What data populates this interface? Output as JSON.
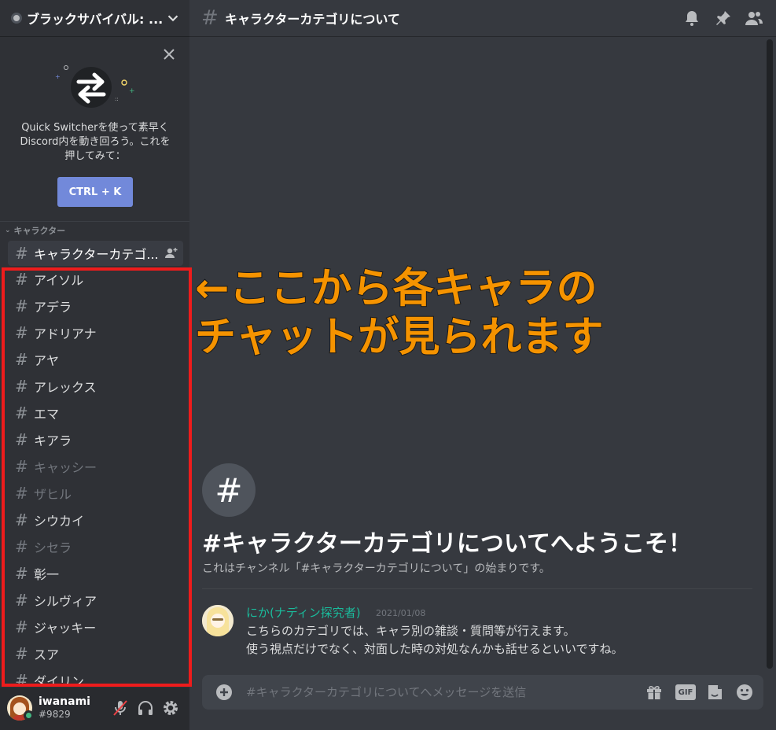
{
  "server": {
    "name": "ブラックサバイバル: ..."
  },
  "quick_switcher": {
    "text_lines": [
      "Quick Switcherを使って素早く",
      "Discord内を動き回ろう。これを",
      "押してみて："
    ],
    "button_label": "CTRL + K"
  },
  "category": {
    "label": "キャラクター"
  },
  "active_channel": {
    "name": "キャラクターカテゴ..."
  },
  "channels": [
    {
      "name": "アイソル",
      "muted": false
    },
    {
      "name": "アデラ",
      "muted": false
    },
    {
      "name": "アドリアナ",
      "muted": false
    },
    {
      "name": "アヤ",
      "muted": false
    },
    {
      "name": "アレックス",
      "muted": false
    },
    {
      "name": "エマ",
      "muted": false
    },
    {
      "name": "キアラ",
      "muted": false
    },
    {
      "name": "キャッシー",
      "muted": true
    },
    {
      "name": "ザヒル",
      "muted": true
    },
    {
      "name": "シウカイ",
      "muted": false
    },
    {
      "name": "シセラ",
      "muted": true
    },
    {
      "name": "彰一",
      "muted": false
    },
    {
      "name": "シルヴィア",
      "muted": false
    },
    {
      "name": "ジャッキー",
      "muted": false
    },
    {
      "name": "スア",
      "muted": false
    },
    {
      "name": "ダイリン",
      "muted": false
    }
  ],
  "user": {
    "name": "iwanami",
    "discriminator": "#9829",
    "status_color": "#43b581"
  },
  "topbar": {
    "channel_title": "キャラクターカテゴリについて"
  },
  "welcome": {
    "title": "#キャラクターカテゴリについてへようこそ！",
    "subtitle": "これはチャンネル「#キャラクターカテゴリについて」の始まりです。"
  },
  "message": {
    "author": "にか(ナディン探究者)",
    "timestamp": "2021/01/08",
    "lines": [
      "こちらのカテゴリでは、キャラ別の雑談・質問等が行えます。",
      "使う視点だけでなく、対面した時の対処なんかも話せるといいですね。"
    ]
  },
  "composer": {
    "placeholder": "#キャラクターカテゴリについてへメッセージを送信",
    "gif_label": "GIF"
  },
  "annotation": {
    "lines": [
      "←ここから各キャラの",
      "チャットが見られます"
    ],
    "color": "#f59300"
  },
  "colors": {
    "accent": "#7289da",
    "highlight_border": "#ee1c1c",
    "author_color": "#1abc9c"
  },
  "icons": [
    "server-icon",
    "chevron-down-icon",
    "close-icon",
    "quick-switcher-icon",
    "add-member-icon",
    "mute-mic-icon",
    "headset-icon",
    "gear-icon",
    "bell-icon",
    "pin-icon",
    "members-icon",
    "add-circle-icon",
    "gift-icon",
    "gif-icon",
    "sticker-icon",
    "emoji-icon"
  ]
}
